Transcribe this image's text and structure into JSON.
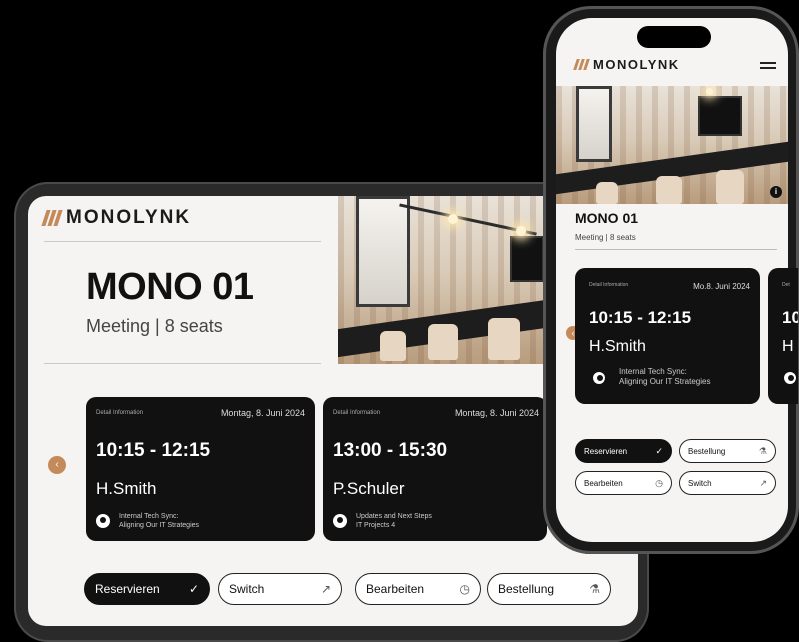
{
  "brand": "MONOLYNK",
  "room": {
    "name": "MONO 01",
    "subtitle_tablet": "Meeting | 8 seats",
    "subtitle_phone": "Meeting | 8 seats"
  },
  "tablet": {
    "bookings": [
      {
        "label": "Detail Information",
        "date": "Montag, 8. Juni 2024",
        "time": "10:15 - 12:15",
        "organizer": "H.Smith",
        "description_line1": "Internal Tech Sync:",
        "description_line2": "Aligning Our IT Strategies"
      },
      {
        "label": "Detail Information",
        "date": "Montag, 8. Juni 2024",
        "time": "13:00 - 15:30",
        "organizer": "P.Schuler",
        "description_line1": "Updates and Next Steps",
        "description_line2": "IT Projects 4"
      }
    ],
    "buttons": {
      "reserve": "Reservieren",
      "switch": "Switch",
      "edit": "Bearbeiten",
      "order": "Bestellung"
    }
  },
  "phone": {
    "booking": {
      "label": "Detail Information",
      "date": "Mo.8. Juni 2024",
      "time": "10:15 - 12:15",
      "organizer": "H.Smith",
      "description_line1": "Internal Tech Sync:",
      "description_line2": "Aligning Our IT Strategies"
    },
    "peek_card": {
      "label": "Det",
      "time": "10",
      "organizer": "H"
    },
    "buttons": {
      "reserve": "Reservieren",
      "order": "Bestellung",
      "edit": "Bearbeiten",
      "switch": "Switch"
    }
  },
  "colors": {
    "accent": "#c48a5a",
    "card": "#111111",
    "screen": "#f5f4f2"
  },
  "icons": {
    "reserve": "check-circle-icon",
    "switch": "arrow-up-right-icon",
    "edit": "clock-icon",
    "order": "flask-icon",
    "prev": "chevron-left-icon",
    "menu": "hamburger-icon",
    "info": "info-icon"
  }
}
